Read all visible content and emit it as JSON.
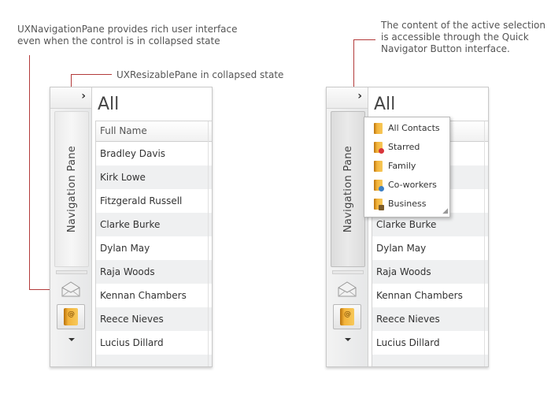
{
  "annotations": {
    "left_top": [
      "UXNavigationPane provides rich user interface",
      "even when the control is in collapsed state"
    ],
    "left_mid": "UXResizablePane in collapsed state",
    "right_top": [
      "The content of the active selection",
      "is accessible through the Quick",
      "Navigator Button interface."
    ]
  },
  "left_panel": {
    "expand_glyph": "›",
    "nav_label": "Navigation Pane",
    "title": "All",
    "column_header": "Full Name",
    "rows": [
      "Bradley Davis",
      "Kirk Lowe",
      "Fitzgerald Russell",
      "Clarke Burke",
      "Dylan May",
      "Raja Woods",
      "Kennan Chambers",
      "Reece Nieves",
      "Lucius Dillard"
    ]
  },
  "right_panel": {
    "expand_glyph": "›",
    "nav_label": "Navigation Pane",
    "title": "All",
    "rows": [
      "Clarke Burke",
      "Dylan May",
      "Raja Woods",
      "Kennan Chambers",
      "Reece Nieves",
      "Lucius Dillard"
    ],
    "popup_items": [
      "All Contacts",
      "Starred",
      "Family",
      "Co-workers",
      "Business"
    ]
  },
  "colors": {
    "annotation_line": "#b33a3a",
    "book_icon": "#f3b33a",
    "row_alt": "#eff0f1"
  }
}
